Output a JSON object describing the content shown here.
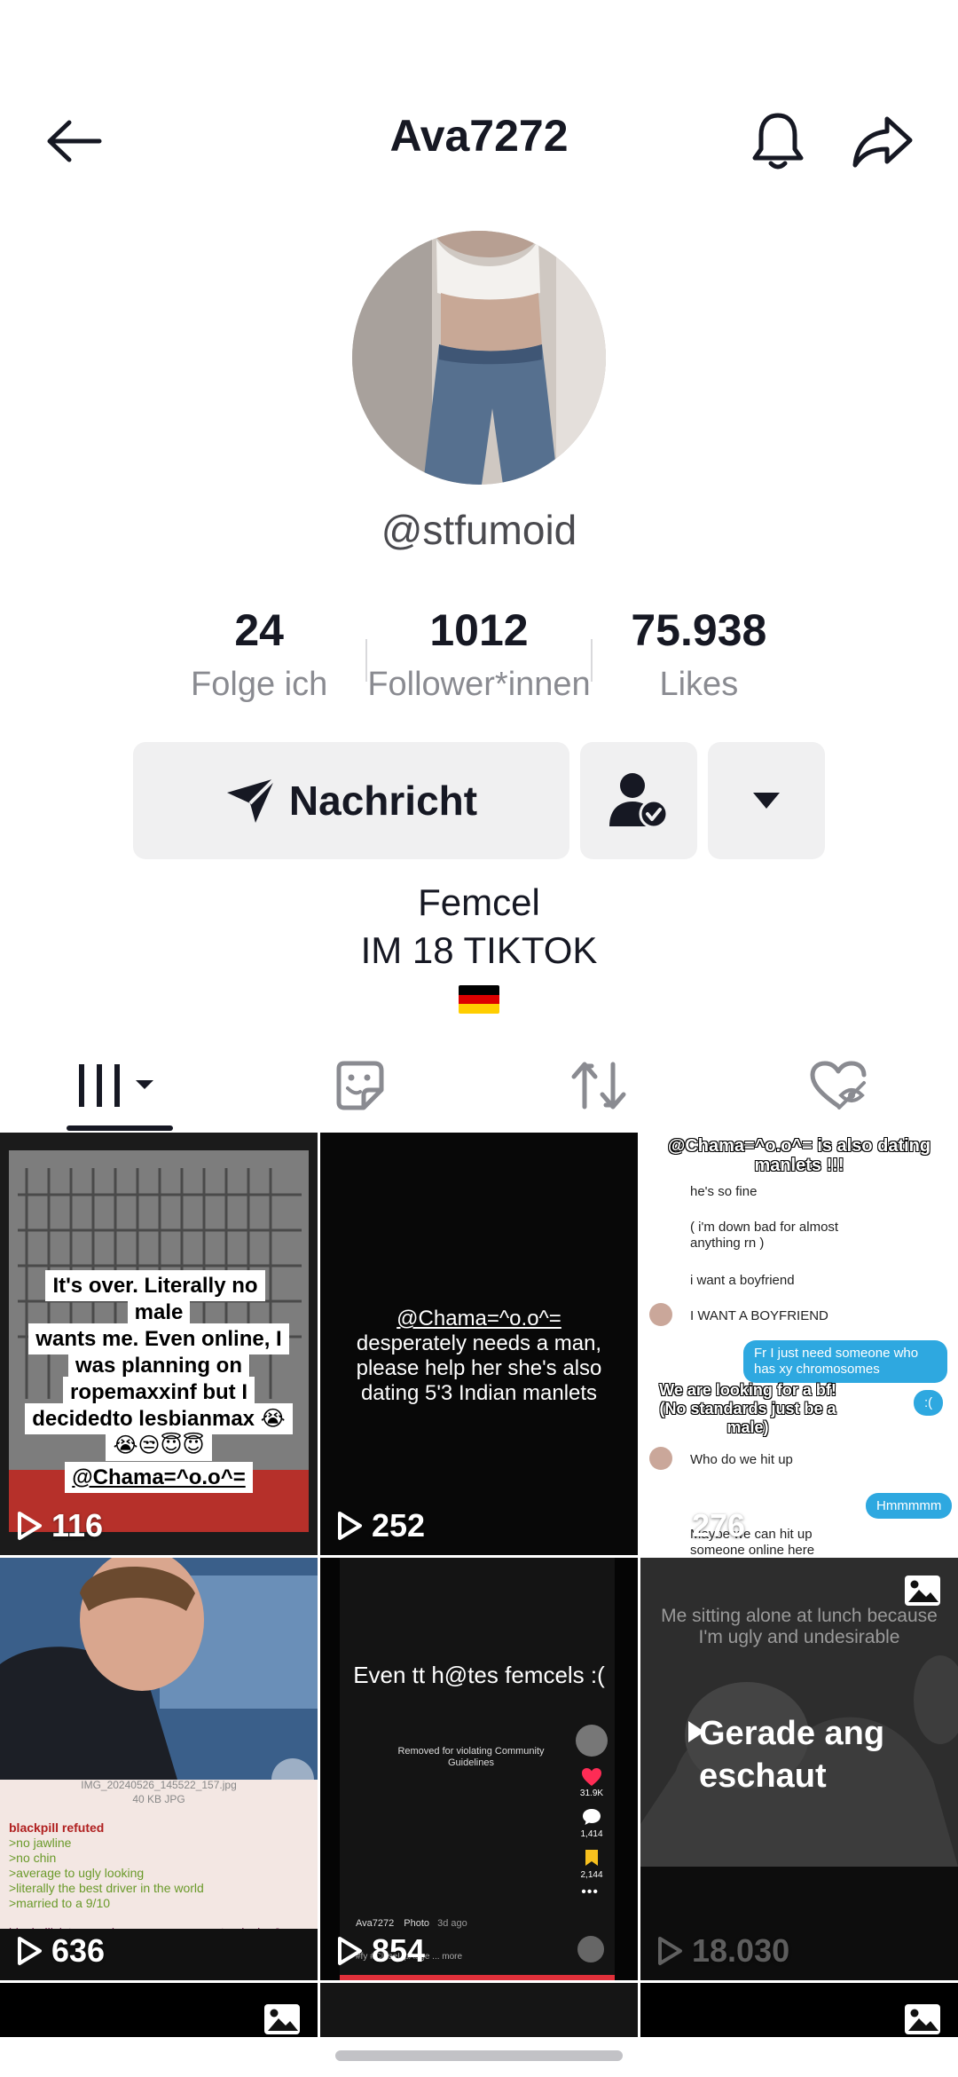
{
  "header": {
    "title": "Ava7272",
    "back_icon": "arrow-left-icon",
    "bell_icon": "bell-icon",
    "share_icon": "share-arrow-icon"
  },
  "profile": {
    "handle": "@stfumoid",
    "stats": [
      {
        "value": "24",
        "label": "Folge ich"
      },
      {
        "value": "1012",
        "label": "Follower*innen"
      },
      {
        "value": "75.938",
        "label": "Likes"
      }
    ],
    "message_label": "Nachricht",
    "bio_line1": "Femcel",
    "bio_line2": "IM 18 TIKTOK",
    "flag": "🇩🇪"
  },
  "tabs": [
    "videos-grid",
    "stickers",
    "reposts",
    "liked-private"
  ],
  "videos": [
    {
      "views": "116",
      "caption_lines": [
        "It's over. Literally no male",
        "wants me. Even online, I",
        "was planning on",
        "ropemaxxinf but I",
        "decidedto lesbianmax 😭",
        "😭😒😇😇"
      ],
      "mention": "@Chama=^o.o^="
    },
    {
      "views": "252",
      "mention": "@Chama=^o.o^=",
      "caption": "desperately needs a man, please help her she's also dating 5'3 Indian manlets"
    },
    {
      "views": "276",
      "top_caption": "@Chama=^o.o^= is also dating manlets !!!",
      "lines": [
        "he's so fine",
        "( i'm down bad for almost anything rn )",
        "i want a boyfriend",
        "I WANT A BOYFRIEND"
      ],
      "blue1": "Fr I just need someone who has xy chromosomes",
      "blue2": ":(",
      "overlay": "We are looking for a bf! (No standards just be a male)",
      "line_who": "Who do we hit up",
      "blue3": "Hmmmmm",
      "line_last": "Maybe we can hit up someone online here"
    },
    {
      "views": "636",
      "file_name": "IMG_20240526_145522_157.jpg",
      "file_meta": "40 KB JPG",
      "green_title": "blackpill refuted",
      "green_lines": [
        ">no jawline",
        ">no chin",
        ">average to ugly looking",
        ">literally the best driver in the world",
        ">married to a 9/10"
      ],
      "footer_text": "blackpillsisters... when are we gonna stop losing?"
    },
    {
      "views": "854",
      "caption": "Even tt h@tes femcels :(",
      "removed": "Removed for violating Community Guidelines",
      "likes": "31.9K",
      "comments": "1,414",
      "saves": "2,144",
      "author": "Ava7272",
      "tag": "Photo",
      "ago": "3d ago",
      "hashtags": "#fy #CloseUpAuge ... more"
    },
    {
      "views": "18.030",
      "caption": "Me sitting alone at lunch because I'm ugly and undesirable",
      "watched_label": "Gerade angeschaut"
    }
  ]
}
